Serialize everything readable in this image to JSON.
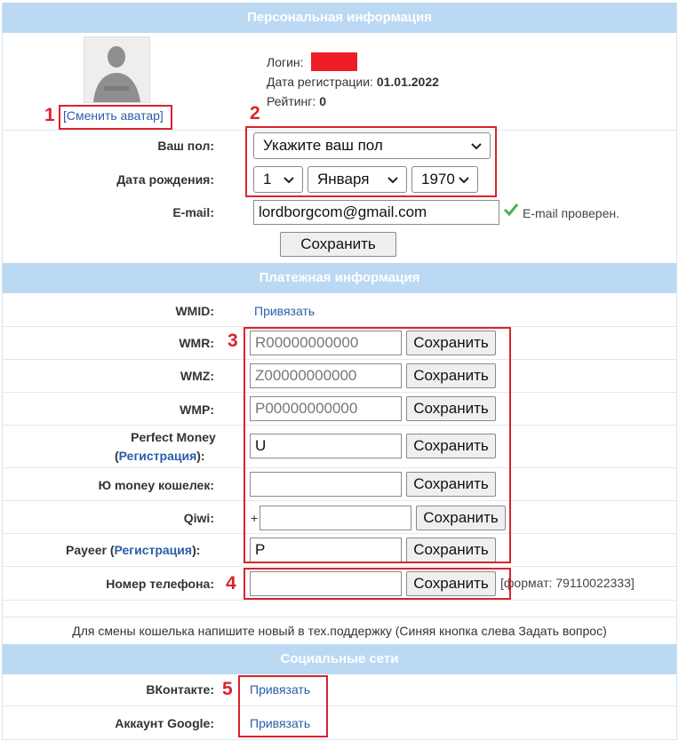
{
  "sections": {
    "personal": "Персональная информация",
    "payment": "Платежная информация",
    "social": "Социальные сети"
  },
  "profile": {
    "change_avatar": "[Сменить аватар]",
    "login_label": "Логин:",
    "reg_date_label": "Дата регистрации:",
    "reg_date_value": "01.01.2022",
    "rating_label": "Рейтинг:",
    "rating_value": "0",
    "gender_label": "Ваш пол:",
    "gender_value": "Укажите ваш пол",
    "birth_label": "Дата рождения:",
    "birth_day": "1",
    "birth_month": "Января",
    "birth_year": "1970",
    "email_label": "E-mail:",
    "email_value": "lordborgcom@gmail.com",
    "email_verified": "E-mail проверен.",
    "save_label": "Сохранить"
  },
  "payment": {
    "wmid_label": "WMID:",
    "wmid_link": "Привязать",
    "wmr_label": "WMR:",
    "wmr_placeholder": "R00000000000",
    "wmz_label": "WMZ:",
    "wmz_placeholder": "Z00000000000",
    "wmp_label": "WMP:",
    "wmp_placeholder": "P00000000000",
    "pm_label": "Perfect Money",
    "pm_open": "(",
    "pm_link": "Регистрация",
    "pm_close": "):",
    "pm_value": "U",
    "yoo_label": "Ю money кошелек:",
    "yoo_value": "",
    "qiwi_label": "Qiwi:",
    "qiwi_prefix": "+",
    "qiwi_value": "",
    "payeer_label": "Payeer (",
    "payeer_link": "Регистрация",
    "payeer_close": "):",
    "payeer_value": "P",
    "phone_label": "Номер телефона:",
    "phone_value": "",
    "phone_format": "[формат: 79110022333]",
    "save_label": "Сохранить",
    "note": "Для смены кошелька напишите новый в тех.поддержку (Синяя кнопка слева Задать вопрос)"
  },
  "social": {
    "vk_label": "ВКонтакте:",
    "vk_link": "Привязать",
    "google_label": "Аккаунт Google:",
    "google_link": "Привязать"
  },
  "annotations": [
    "1",
    "2",
    "3",
    "4",
    "5"
  ],
  "colors": {
    "header_bg": "#bcd9f4",
    "link": "#2a5ea8",
    "annotation_red": "#d9232d",
    "login_redaction": "#ee1c24",
    "check_green": "#4caf50"
  }
}
